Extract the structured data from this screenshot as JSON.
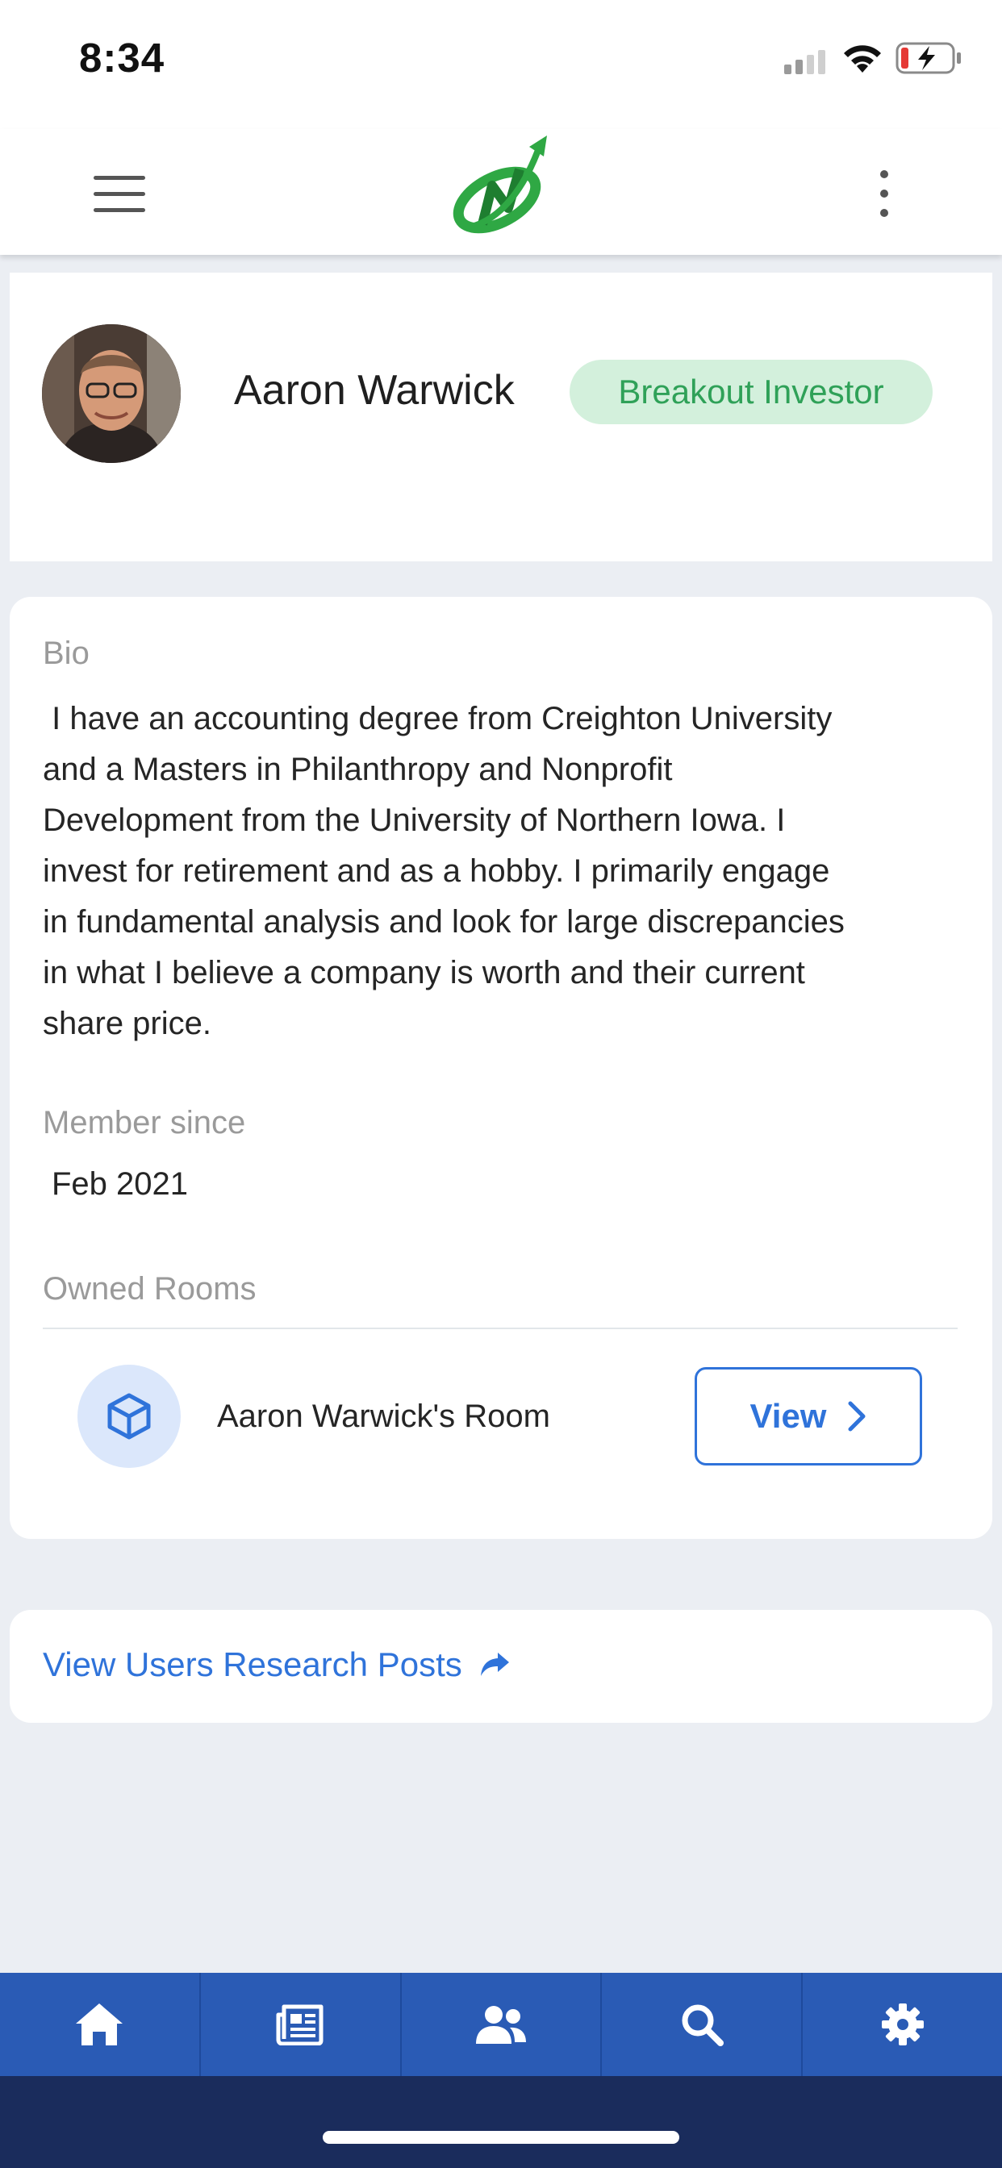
{
  "status_bar": {
    "time": "8:34"
  },
  "profile": {
    "name": "Aaron Warwick",
    "badge": "Breakout Investor"
  },
  "info": {
    "bio_label": "Bio",
    "bio_text": " I have an accounting degree from Creighton University\nand a Masters in Philanthropy and Nonprofit\nDevelopment from the University of Northern Iowa. I\ninvest for retirement and as a hobby. I primarily engage\nin fundamental analysis and look for large discrepancies\nin what I believe a company is worth and their current\nshare price.",
    "member_since_label": "Member since",
    "member_since_value": "Feb 2021",
    "owned_rooms_label": "Owned Rooms",
    "rooms": [
      {
        "name": "Aaron Warwick's Room",
        "action_label": "View"
      }
    ]
  },
  "research": {
    "link_label": "View Users Research Posts"
  },
  "tabbar": {
    "tabs": [
      {
        "icon": "home-icon"
      },
      {
        "icon": "newspaper-icon"
      },
      {
        "icon": "users-icon"
      },
      {
        "icon": "search-icon"
      },
      {
        "icon": "gear-icon"
      }
    ]
  },
  "colors": {
    "accent": "#2f73da",
    "badge_bg": "#d3f0dc",
    "badge_text": "#2fa158",
    "tabbar_bg": "#2a5bb5",
    "home_area_bg": "#1a2c5c",
    "logo_green": "#2fa844"
  }
}
